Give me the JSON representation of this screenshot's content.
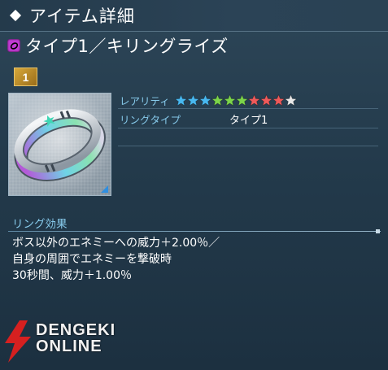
{
  "header": {
    "title": "アイテム詳細"
  },
  "item": {
    "name": "タイプ1／キリングライズ",
    "quantity": "1",
    "type_icon_color": "#c23bd4"
  },
  "properties": {
    "rarity_label": "レアリティ",
    "rarity_stars": 10,
    "rarity_star_colors": [
      "#48b8f0",
      "#48b8f0",
      "#48b8f0",
      "#7cd44a",
      "#7cd44a",
      "#7cd44a",
      "#ef5a5a",
      "#ef5a5a",
      "#ef5a5a",
      "#e8e8e8"
    ],
    "ring_type_label": "リングタイプ",
    "ring_type_value": "タイプ1"
  },
  "effect": {
    "label": "リング効果",
    "text": "ボス以外のエネミーへの威力＋2.00％／\n自身の周囲でエネミーを撃破時\n30秒間、威力＋1.00％"
  },
  "watermark": {
    "line1": "DENGEKI",
    "line2": "ONLINE"
  }
}
